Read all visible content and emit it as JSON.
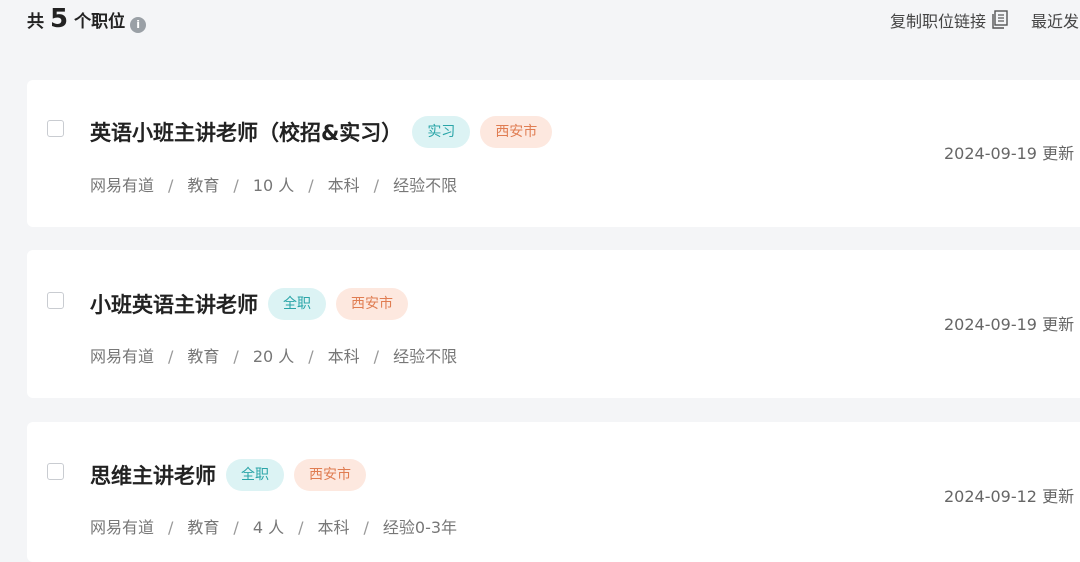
{
  "header": {
    "count_prefix": "共",
    "count_value": "5",
    "count_suffix": "个职位",
    "info_icon": "info-icon",
    "copy_link_label": "复制职位链接",
    "copy_icon": "copy-icon",
    "sort_label": "最近发"
  },
  "jobs": [
    {
      "title": "英语小班主讲老师（校招&实习）",
      "type_tag": "实习",
      "city_tag": "西安市",
      "company": "网易有道",
      "category": "教育",
      "headcount": "10 人",
      "education": "本科",
      "experience": "经验不限",
      "updated": "2024-09-19 更新"
    },
    {
      "title": "小班英语主讲老师",
      "type_tag": "全职",
      "city_tag": "西安市",
      "company": "网易有道",
      "category": "教育",
      "headcount": "20 人",
      "education": "本科",
      "experience": "经验不限",
      "updated": "2024-09-19 更新"
    },
    {
      "title": "思维主讲老师",
      "type_tag": "全职",
      "city_tag": "西安市",
      "company": "网易有道",
      "category": "教育",
      "headcount": "4 人",
      "education": "本科",
      "experience": "经验0-3年",
      "updated": "2024-09-12 更新"
    }
  ],
  "meta_separator": "/",
  "colors": {
    "page_background": "#f4f5f7",
    "type_tag_bg": "#dcf3f4",
    "type_tag_text": "#2aa5a8",
    "city_tag_bg": "#fde8df",
    "city_tag_text": "#e07d52"
  }
}
